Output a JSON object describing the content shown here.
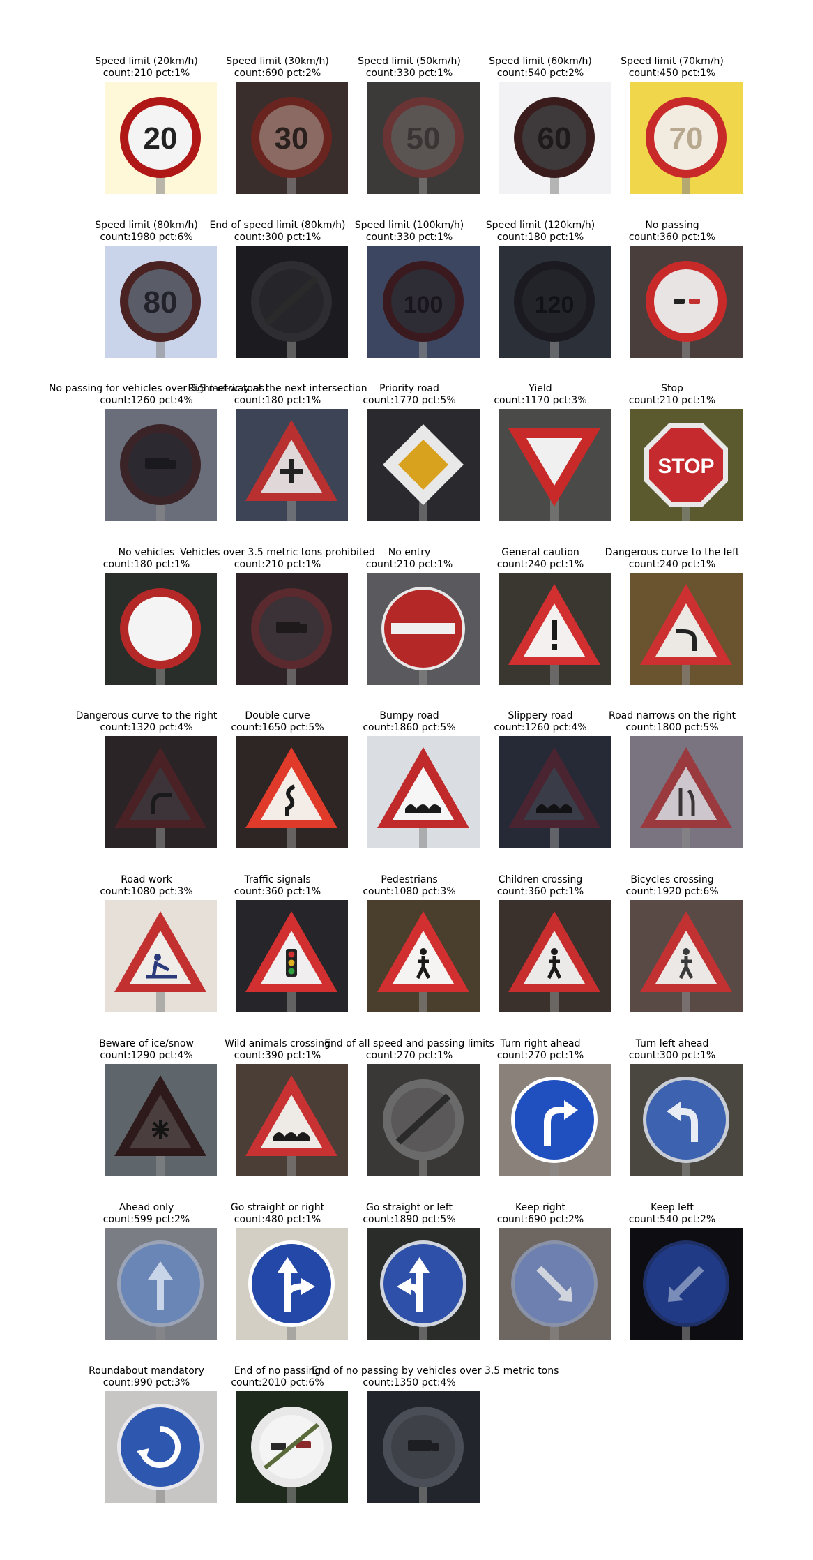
{
  "signs": [
    {
      "title": "Speed limit (20km/h)",
      "stats": "count:210 pct:1%",
      "icon": "speed-20-sign",
      "bg": "#fff8d8",
      "shape": "circle",
      "ring": "#b01818",
      "fill": "#f4f4f4",
      "sym": "20",
      "symColor": "#222222"
    },
    {
      "title": "Speed limit (30km/h)",
      "stats": "count:690 pct:2%",
      "icon": "speed-30-sign",
      "bg": "#3a2e2c",
      "shape": "circle",
      "ring": "#6a2420",
      "fill": "#8a6a62",
      "sym": "30",
      "symColor": "#2a201e"
    },
    {
      "title": "Speed limit (50km/h)",
      "stats": "count:330 pct:1%",
      "icon": "speed-50-sign",
      "bg": "#3c3a38",
      "shape": "circle",
      "ring": "#6a3434",
      "fill": "#5a5452",
      "sym": "50",
      "symColor": "#3a3434"
    },
    {
      "title": "Speed limit (60km/h)",
      "stats": "count:540 pct:2%",
      "icon": "speed-60-sign",
      "bg": "#f2f2f4",
      "shape": "circle",
      "ring": "#3a1c1c",
      "fill": "#3e3a3c",
      "sym": "60",
      "symColor": "#1e1a1c"
    },
    {
      "title": "Speed limit (70km/h)",
      "stats": "count:450 pct:1%",
      "icon": "speed-70-sign",
      "bg": "#efd64a",
      "shape": "circle",
      "ring": "#c82a2a",
      "fill": "#f2ece0",
      "sym": "70",
      "symColor": "#b8a890"
    },
    {
      "title": "Speed limit (80km/h)",
      "stats": "count:1980 pct:6%",
      "icon": "speed-80-sign",
      "bg": "#c9d3ea",
      "shape": "circle",
      "ring": "#4a2222",
      "fill": "#5a5c68",
      "sym": "80",
      "symColor": "#22222a"
    },
    {
      "title": "End of speed limit (80km/h)",
      "stats": "count:300 pct:1%",
      "icon": "end-speed-80-sign",
      "bg": "#1c1c20",
      "shape": "circle",
      "ring": "#2e2e32",
      "fill": "#26262a",
      "sym": "80",
      "symColor": "#323236"
    },
    {
      "title": "Speed limit (100km/h)",
      "stats": "count:330 pct:1%",
      "icon": "speed-100-sign",
      "bg": "#3c4660",
      "shape": "circle",
      "ring": "#3a1a1e",
      "fill": "#2e2c34",
      "sym": "100",
      "symColor": "#18161c"
    },
    {
      "title": "Speed limit (120km/h)",
      "stats": "count:180 pct:1%",
      "icon": "speed-120-sign",
      "bg": "#2c3038",
      "shape": "circle",
      "ring": "#1a1a20",
      "fill": "#22242a",
      "sym": "120",
      "symColor": "#121216"
    },
    {
      "title": "No passing",
      "stats": "count:360 pct:1%",
      "icon": "no-passing-sign",
      "bg": "#4a3e3c",
      "shape": "circle",
      "ring": "#c82a2a",
      "fill": "#e8e4e4",
      "sym": "",
      "symColor": "#c23030"
    },
    {
      "title": "No passing for vehicles over 3.5 metric tons",
      "stats": "count:1260 pct:4%",
      "icon": "no-passing-trucks-sign",
      "bg": "#6a6e7a",
      "shape": "circle",
      "ring": "#3a2428",
      "fill": "#2c2a30",
      "sym": "",
      "symColor": "#1a1a1e"
    },
    {
      "title": "Right-of-way at the next intersection",
      "stats": "count:180 pct:1%",
      "icon": "right-of-way-sign",
      "bg": "#3c4456",
      "shape": "triangle",
      "ring": "#b83030",
      "fill": "#e0d8d8",
      "sym": "",
      "symColor": "#222222"
    },
    {
      "title": "Priority road",
      "stats": "count:1770 pct:5%",
      "icon": "priority-road-sign",
      "bg": "#2a2a2e",
      "shape": "diamond",
      "ring": "#e8e8e8",
      "fill": "#d9a21e",
      "sym": "",
      "symColor": "#222222"
    },
    {
      "title": "Yield",
      "stats": "count:1170 pct:3%",
      "icon": "yield-sign",
      "bg": "#4a4a48",
      "shape": "invtriangle",
      "ring": "#c82a2a",
      "fill": "#f0f0f0",
      "sym": "",
      "symColor": "#222222"
    },
    {
      "title": "Stop",
      "stats": "count:210 pct:1%",
      "icon": "stop-sign",
      "bg": "#5a5a2e",
      "shape": "octagon",
      "ring": "#e8e8e8",
      "fill": "#c42a2e",
      "sym": "STOP",
      "symColor": "#ffffff"
    },
    {
      "title": "No vehicles",
      "stats": "count:180 pct:1%",
      "icon": "no-vehicles-sign",
      "bg": "#2a2e2a",
      "shape": "circle",
      "ring": "#b42828",
      "fill": "#f4f4f4",
      "sym": "",
      "symColor": "#222222"
    },
    {
      "title": "Vehicles over 3.5 metric tons prohibited",
      "stats": "count:210 pct:1%",
      "icon": "no-trucks-sign",
      "bg": "#2e2428",
      "shape": "circle",
      "ring": "#5a2a2e",
      "fill": "#3a3236",
      "sym": "",
      "symColor": "#1e1a1c"
    },
    {
      "title": "No entry",
      "stats": "count:210 pct:1%",
      "icon": "no-entry-sign",
      "bg": "#5a5a5e",
      "shape": "noentry",
      "ring": "#b42828",
      "fill": "#b42828",
      "sym": "",
      "symColor": "#f0f0f0"
    },
    {
      "title": "General caution",
      "stats": "count:240 pct:1%",
      "icon": "general-caution-sign",
      "bg": "#3a3630",
      "shape": "triangle",
      "ring": "#d23030",
      "fill": "#f4f0f0",
      "sym": "!",
      "symColor": "#1a1a1a"
    },
    {
      "title": "Dangerous curve to the left",
      "stats": "count:240 pct:1%",
      "icon": "curve-left-sign",
      "bg": "#6a5430",
      "shape": "triangle",
      "ring": "#cc3030",
      "fill": "#ece8e4",
      "sym": "",
      "symColor": "#222222"
    },
    {
      "title": "Dangerous curve to the right",
      "stats": "count:1320 pct:4%",
      "icon": "curve-right-sign",
      "bg": "#2a2426",
      "shape": "triangle",
      "ring": "#4a2226",
      "fill": "#3c3438",
      "sym": "",
      "symColor": "#1a1a1a"
    },
    {
      "title": "Double curve",
      "stats": "count:1650 pct:5%",
      "icon": "double-curve-sign",
      "bg": "#2e2624",
      "shape": "triangle",
      "ring": "#e03a2a",
      "fill": "#f4ece6",
      "sym": "",
      "symColor": "#1a1a1a"
    },
    {
      "title": "Bumpy road",
      "stats": "count:1860 pct:5%",
      "icon": "bumpy-road-sign",
      "bg": "#dadee2",
      "shape": "triangle",
      "ring": "#c02a2a",
      "fill": "#f6f6f6",
      "sym": "",
      "symColor": "#1a1a1a"
    },
    {
      "title": "Slippery road",
      "stats": "count:1260 pct:4%",
      "icon": "slippery-road-sign",
      "bg": "#262a36",
      "shape": "triangle",
      "ring": "#4a2430",
      "fill": "#3a3c48",
      "sym": "",
      "symColor": "#121214"
    },
    {
      "title": "Road narrows on the right",
      "stats": "count:1800 pct:5%",
      "icon": "road-narrows-sign",
      "bg": "#7a7480",
      "shape": "triangle",
      "ring": "#9a3a3e",
      "fill": "#cdc6cc",
      "sym": "",
      "symColor": "#3a3436"
    },
    {
      "title": "Road work",
      "stats": "count:1080 pct:3%",
      "icon": "road-work-sign",
      "bg": "#e6e0d8",
      "shape": "triangle",
      "ring": "#c23030",
      "fill": "#f0ece8",
      "sym": "",
      "symColor": "#2a3a7a"
    },
    {
      "title": "Traffic signals",
      "stats": "count:360 pct:1%",
      "icon": "traffic-signals-sign",
      "bg": "#26262a",
      "shape": "triangle",
      "ring": "#d23030",
      "fill": "#f0eeee",
      "sym": "",
      "symColor": "#222222"
    },
    {
      "title": "Pedestrians",
      "stats": "count:1080 pct:3%",
      "icon": "pedestrians-sign",
      "bg": "#4a3e2c",
      "shape": "triangle",
      "ring": "#d23030",
      "fill": "#f6f4f2",
      "sym": "",
      "symColor": "#1a1a1a"
    },
    {
      "title": "Children crossing",
      "stats": "count:360 pct:1%",
      "icon": "children-crossing-sign",
      "bg": "#3a302c",
      "shape": "triangle",
      "ring": "#c82e2e",
      "fill": "#eceae8",
      "sym": "",
      "symColor": "#1a1a1a"
    },
    {
      "title": "Bicycles crossing",
      "stats": "count:1920 pct:6%",
      "icon": "bicycles-crossing-sign",
      "bg": "#5a4a46",
      "shape": "triangle",
      "ring": "#c23232",
      "fill": "#ece8e6",
      "sym": "",
      "symColor": "#3a3a3a"
    },
    {
      "title": "Beware of ice/snow",
      "stats": "count:1290 pct:4%",
      "icon": "ice-snow-sign",
      "bg": "#5e666c",
      "shape": "triangle",
      "ring": "#2e1a1a",
      "fill": "#4a3e3e",
      "sym": "",
      "symColor": "#141414"
    },
    {
      "title": "Wild animals crossing",
      "stats": "count:390 pct:1%",
      "icon": "wild-animals-sign",
      "bg": "#4a3e36",
      "shape": "triangle",
      "ring": "#c83232",
      "fill": "#eeeae6",
      "sym": "",
      "symColor": "#1a1a1a"
    },
    {
      "title": "End of all speed and passing limits",
      "stats": "count:270 pct:1%",
      "icon": "end-all-limits-sign",
      "bg": "#3a3836",
      "shape": "circle",
      "ring": "#6a6a6a",
      "fill": "#5a5858",
      "sym": "",
      "symColor": "#2a2a2a"
    },
    {
      "title": "Turn right ahead",
      "stats": "count:270 pct:1%",
      "icon": "turn-right-sign",
      "bg": "#8a827a",
      "shape": "bluecircle",
      "ring": "#ffffff",
      "fill": "#2050c0",
      "sym": "",
      "symColor": "#ffffff"
    },
    {
      "title": "Turn left ahead",
      "stats": "count:300 pct:1%",
      "icon": "turn-left-sign",
      "bg": "#4a4640",
      "shape": "bluecircle",
      "ring": "#c8ccd4",
      "fill": "#3c62b0",
      "sym": "",
      "symColor": "#e8ecf4"
    },
    {
      "title": "Ahead only",
      "stats": "count:599 pct:2%",
      "icon": "ahead-only-sign",
      "bg": "#7a7e84",
      "shape": "bluecircle",
      "ring": "#9aa4b6",
      "fill": "#6a86b6",
      "sym": "",
      "symColor": "#c8d4e8"
    },
    {
      "title": "Go straight or right",
      "stats": "count:480 pct:1%",
      "icon": "straight-or-right-sign",
      "bg": "#d4cfc4",
      "shape": "bluecircle",
      "ring": "#ffffff",
      "fill": "#2448a8",
      "sym": "",
      "symColor": "#ffffff"
    },
    {
      "title": "Go straight or left",
      "stats": "count:1890 pct:5%",
      "icon": "straight-or-left-sign",
      "bg": "#2a2c2a",
      "shape": "bluecircle",
      "ring": "#d0d4dc",
      "fill": "#2e50a8",
      "sym": "",
      "symColor": "#ffffff"
    },
    {
      "title": "Keep right",
      "stats": "count:690 pct:2%",
      "icon": "keep-right-sign",
      "bg": "#6e6660",
      "shape": "bluecircle",
      "ring": "#8a92a8",
      "fill": "#6e80b0",
      "sym": "",
      "symColor": "#d0d4dc"
    },
    {
      "title": "Keep left",
      "stats": "count:540 pct:2%",
      "icon": "keep-left-sign",
      "bg": "#0e0e12",
      "shape": "bluecircle",
      "ring": "#1e3066",
      "fill": "#203a86",
      "sym": "",
      "symColor": "#7a8cb8"
    },
    {
      "title": "Roundabout mandatory",
      "stats": "count:990 pct:3%",
      "icon": "roundabout-sign",
      "bg": "#c8c6c4",
      "shape": "bluecircle",
      "ring": "#e8e8ec",
      "fill": "#2e58b0",
      "sym": "",
      "symColor": "#ffffff"
    },
    {
      "title": "End of no passing",
      "stats": "count:2010 pct:6%",
      "icon": "end-no-passing-sign",
      "bg": "#1e2a1c",
      "shape": "circle",
      "ring": "#e8e8e8",
      "fill": "#f4f4f4",
      "sym": "",
      "symColor": "#3a3a3a"
    },
    {
      "title": "End of no passing by vehicles over 3.5 metric tons",
      "stats": "count:1350 pct:4%",
      "icon": "end-no-passing-trucks-sign",
      "bg": "#22262c",
      "shape": "circle",
      "ring": "#4a4e56",
      "fill": "#3e4248",
      "sym": "",
      "symColor": "#1c1e22"
    }
  ]
}
